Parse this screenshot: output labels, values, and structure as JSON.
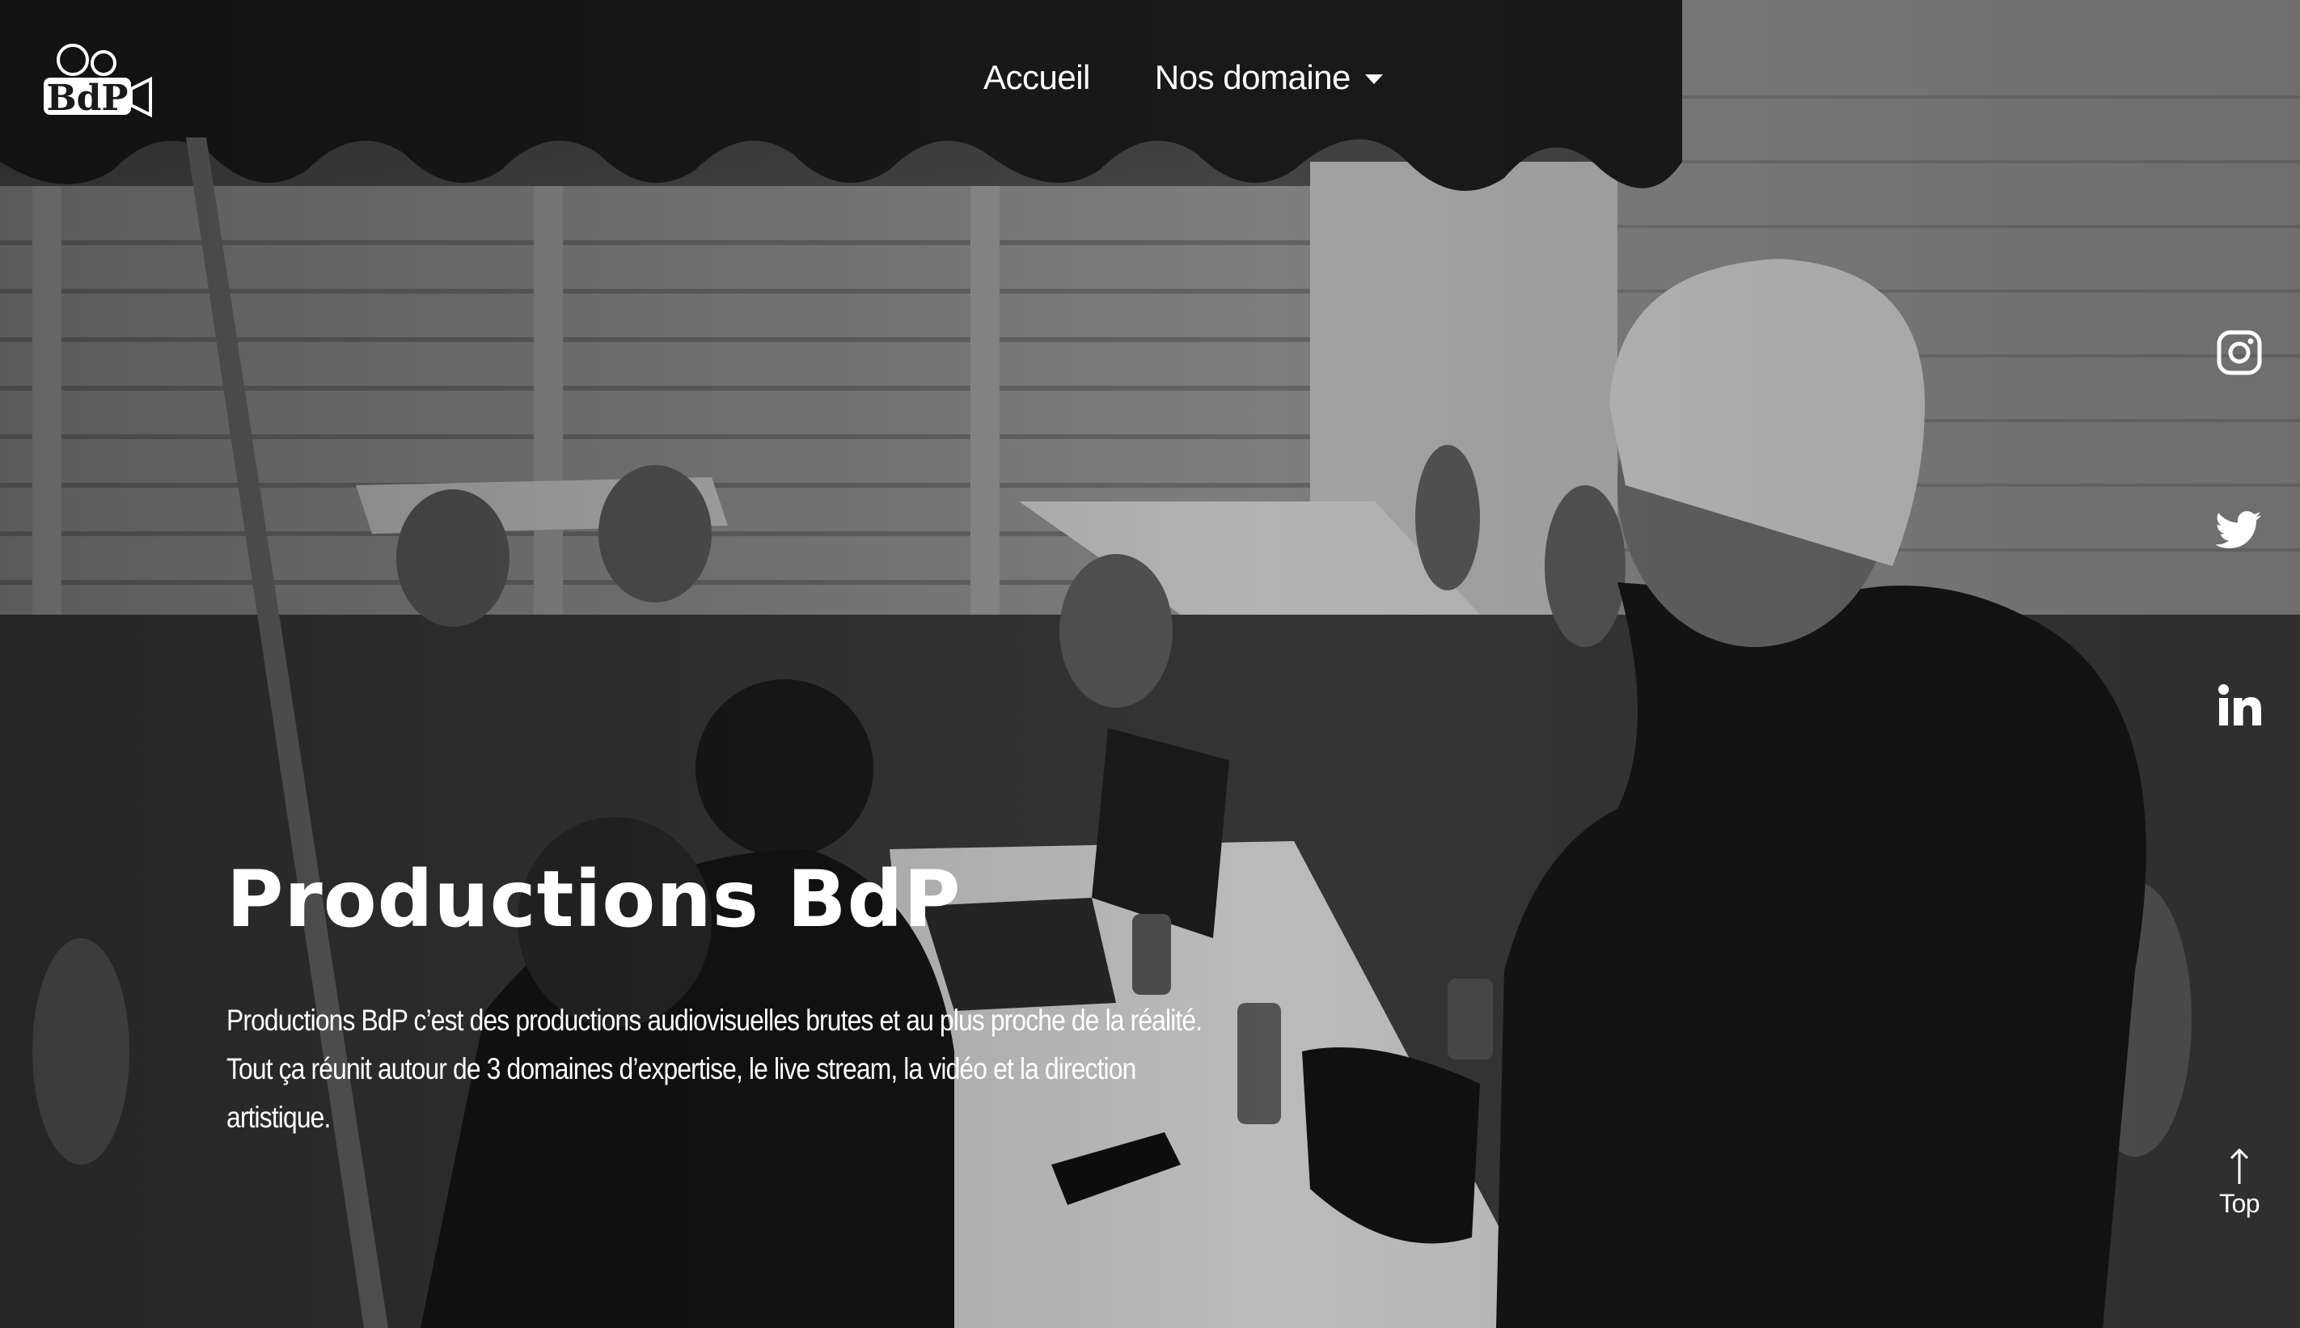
{
  "brand": {
    "logo_text": "BdP"
  },
  "nav": {
    "items": [
      {
        "label": "Accueil"
      },
      {
        "label": "Nos domaine"
      }
    ]
  },
  "hero": {
    "title": "Productions BdP",
    "description": "Productions BdP c’est des productions audiovisuelles brutes et au plus proche de la réalité. Tout ça réunit autour de 3 domaines d’expertise, le live stream, la vidéo et la direction artistique."
  },
  "social": [
    {
      "icon": "instagram-icon"
    },
    {
      "icon": "twitter-icon"
    },
    {
      "icon": "linkedin-icon"
    }
  ],
  "scroll_top": {
    "label": "Top"
  },
  "colors": {
    "text": "#ffffff",
    "overlay": "#1a1a1a"
  }
}
